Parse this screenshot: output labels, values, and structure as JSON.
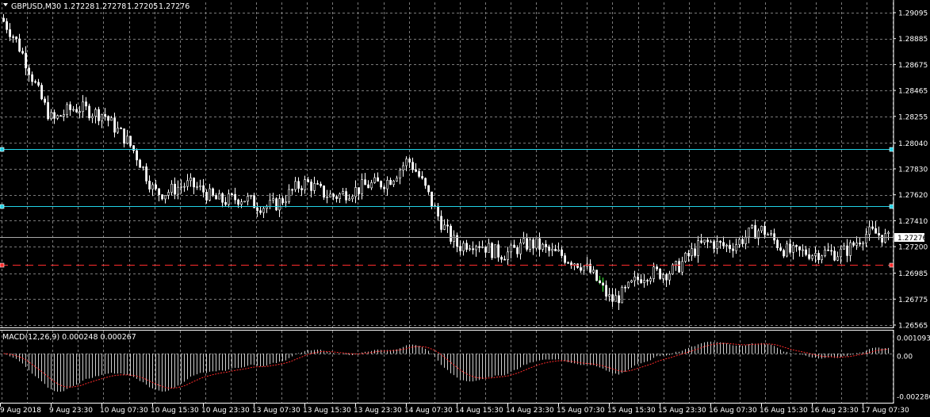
{
  "header": {
    "symbol": "GBPUSD,M30",
    "open": "1.27228",
    "high": "1.27278",
    "low": "1.27205",
    "close": "1.27276"
  },
  "price_axis": {
    "ticks": [
      "1.29095",
      "1.28885",
      "1.28675",
      "1.28465",
      "1.28255",
      "1.28040",
      "1.27830",
      "1.27620",
      "1.27410",
      "1.27200",
      "1.26985",
      "1.26775",
      "1.26565"
    ],
    "current_price": "1.27276"
  },
  "levels": [
    {
      "name": "support-resistance-upper",
      "price": 1.2799,
      "color": "#22d3e6",
      "style": "solid"
    },
    {
      "name": "support-resistance-middle",
      "price": 1.2753,
      "color": "#22d3e6",
      "style": "solid"
    },
    {
      "name": "support-level-lower",
      "price": 1.2705,
      "color": "#ff2b2b",
      "style": "dashed"
    }
  ],
  "macd": {
    "label": "MACD(12,26,9) 0.000248 0.000267",
    "ticks": [
      "0.001093",
      "0.00",
      "-0.002286"
    ]
  },
  "time_axis": {
    "labels": [
      "9 Aug 2018",
      "9 Aug 23:30",
      "10 Aug 07:30",
      "10 Aug 15:30",
      "10 Aug 23:30",
      "13 Aug 07:30",
      "13 Aug 15:30",
      "13 Aug 23:30",
      "14 Aug 07:30",
      "14 Aug 15:30",
      "14 Aug 23:30",
      "15 Aug 07:30",
      "15 Aug 15:30",
      "15 Aug 23:30",
      "16 Aug 07:30",
      "16 Aug 15:30",
      "16 Aug 23:30",
      "17 Aug 07:30"
    ]
  },
  "colors": {
    "background": "#000000",
    "grid": "#7a7a7a",
    "bull_body": "#000000",
    "bear_body": "#ffffff",
    "wick": "#ffffff",
    "accent_wick": "#3cff3c",
    "macd_hist": "#cfcfcf",
    "macd_signal": "#ff2b2b",
    "current_price_line": "#a9a9a9"
  },
  "chart_data": {
    "type": "line",
    "title": "GBPUSD,M30",
    "xlabel": "",
    "ylabel": "",
    "ylim": [
      1.26565,
      1.29095
    ],
    "anchor_times": [
      "9 Aug 2018",
      "9 Aug 23:30",
      "10 Aug 07:30",
      "10 Aug 15:30",
      "10 Aug 23:30",
      "13 Aug 07:30",
      "13 Aug 15:30",
      "13 Aug 23:30",
      "14 Aug 07:30",
      "14 Aug 15:30",
      "14 Aug 23:30",
      "15 Aug 07:30",
      "15 Aug 15:30",
      "15 Aug 23:30",
      "16 Aug 07:30",
      "16 Aug 15:30",
      "16 Aug 23:30",
      "17 Aug 07:30"
    ],
    "approx_close_at_anchors": [
      1.2905,
      1.2825,
      1.2832,
      1.2768,
      1.2765,
      1.2752,
      1.2768,
      1.2762,
      1.2788,
      1.272,
      1.2718,
      1.2718,
      1.268,
      1.27,
      1.2722,
      1.273,
      1.271,
      1.2727
    ],
    "macd_range": [
      -0.002286,
      0.001093
    ]
  }
}
